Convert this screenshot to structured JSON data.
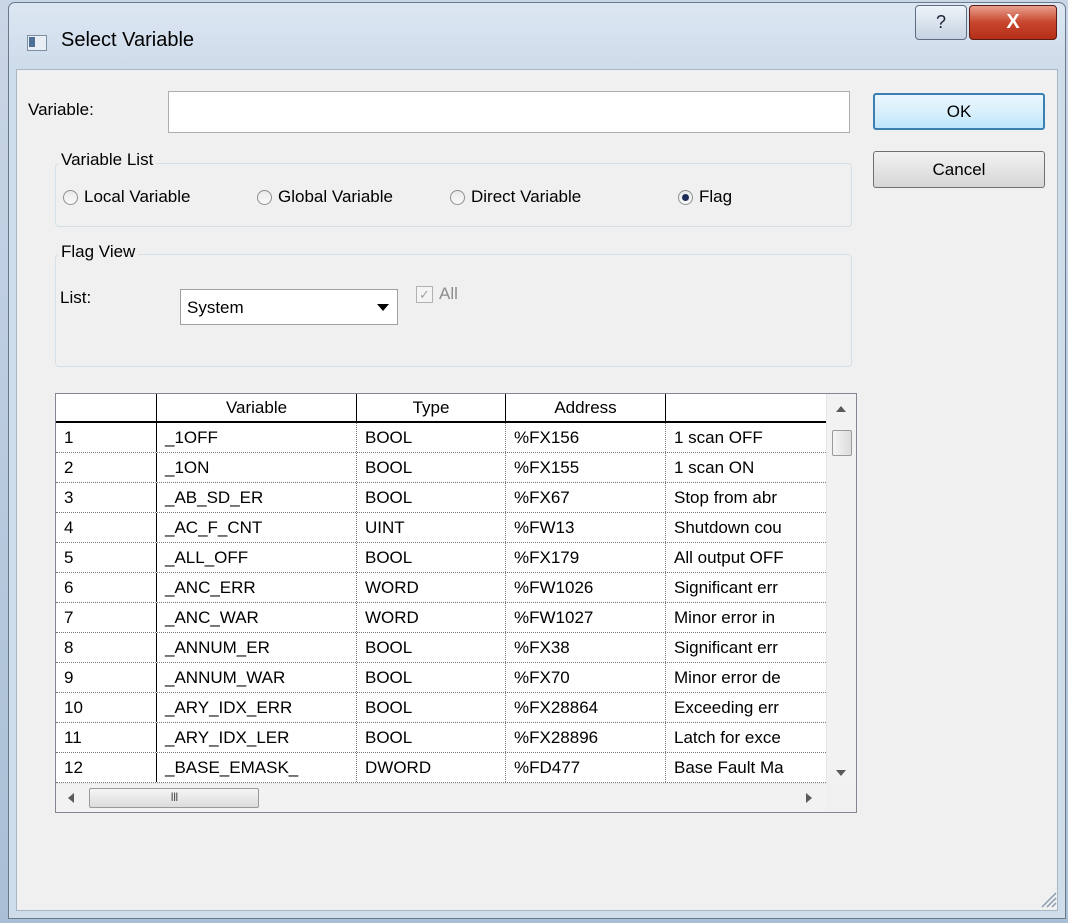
{
  "window": {
    "title": "Select Variable",
    "help_glyph": "?",
    "close_glyph": "X"
  },
  "variable": {
    "label": "Variable:",
    "value": ""
  },
  "buttons": {
    "ok": "OK",
    "cancel": "Cancel"
  },
  "variable_list": {
    "title": "Variable List",
    "options": [
      "Local Variable",
      "Global Variable",
      "Direct Variable",
      "Flag"
    ],
    "selected": "Flag"
  },
  "flag_view": {
    "title": "Flag View",
    "list_label": "List:",
    "list_value": "System",
    "all_label": "All",
    "all_checked": true
  },
  "grid": {
    "columns": [
      "",
      "Variable",
      "Type",
      "Address",
      ""
    ],
    "rows": [
      [
        "1",
        "_1OFF",
        "BOOL",
        "%FX156",
        "1 scan OFF"
      ],
      [
        "2",
        "_1ON",
        "BOOL",
        "%FX155",
        "1 scan ON"
      ],
      [
        "3",
        "_AB_SD_ER",
        "BOOL",
        "%FX67",
        "Stop from abr"
      ],
      [
        "4",
        "_AC_F_CNT",
        "UINT",
        "%FW13",
        "Shutdown cou"
      ],
      [
        "5",
        "_ALL_OFF",
        "BOOL",
        "%FX179",
        "All output OFF"
      ],
      [
        "6",
        "_ANC_ERR",
        "WORD",
        "%FW1026",
        "Significant err"
      ],
      [
        "7",
        "_ANC_WAR",
        "WORD",
        "%FW1027",
        "Minor error in"
      ],
      [
        "8",
        "_ANNUM_ER",
        "BOOL",
        "%FX38",
        "Significant err"
      ],
      [
        "9",
        "_ANNUM_WAR",
        "BOOL",
        "%FX70",
        "Minor error de"
      ],
      [
        "10",
        "_ARY_IDX_ERR",
        "BOOL",
        "%FX28864",
        "Exceeding err"
      ],
      [
        "11",
        "_ARY_IDX_LER",
        "BOOL",
        "%FX28896",
        "Latch for exce"
      ],
      [
        "12",
        "_BASE_EMASK_",
        "DWORD",
        "%FD477",
        "Base Fault Ma"
      ]
    ],
    "hscroll_thumb_glyph": "III"
  }
}
